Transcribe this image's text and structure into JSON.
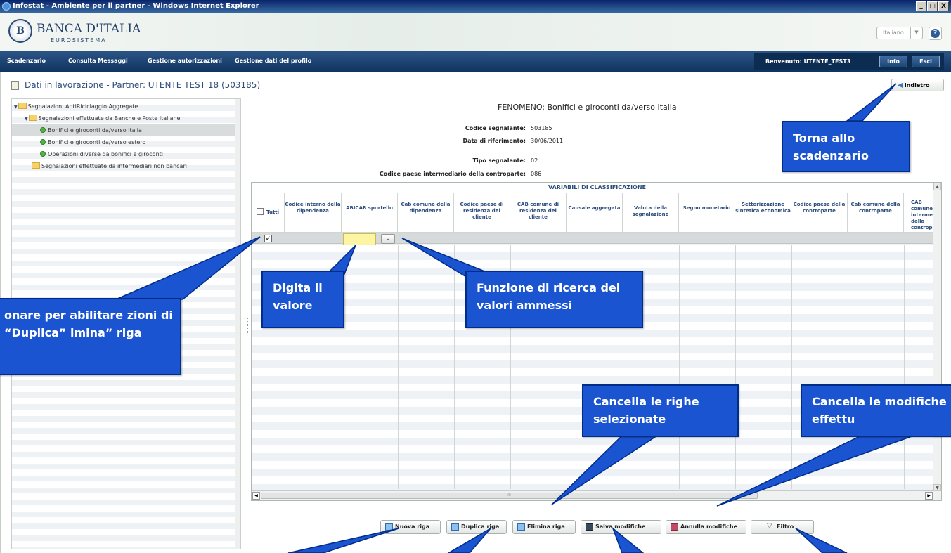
{
  "window": {
    "title": "Infostat - Ambiente per il partner - Windows Internet Explorer",
    "controls": [
      "_",
      "□",
      "X"
    ]
  },
  "header": {
    "logo_name": "BANCA D'ITALIA",
    "logo_sub": "EUROSISTEMA",
    "language": "Italiano",
    "help_icon": "question-icon"
  },
  "nav": {
    "items": [
      "Scadenzario",
      "Consulta Messaggi",
      "Gestione autorizzazioni",
      "Gestione dati del profilo"
    ],
    "welcome": "Benvenuto:  UTENTE_TEST3",
    "info": "Info",
    "exit": "Esci"
  },
  "page": {
    "title": "Dati in lavorazione - Partner: UTENTE TEST 18 (503185)",
    "back": "Indietro"
  },
  "tree": {
    "items": [
      "Segnalazioni AntiRiciclaggio Aggregate",
      "Segnalazioni effettuate da  Banche e Poste Italiane",
      "Bonifici e giroconti da/verso Italia",
      "Bonifici e giroconti da/verso estero",
      "Operazioni diverse da bonifici e giroconti",
      "Segnalazioni effettuate da intermediari non bancari"
    ]
  },
  "info": {
    "fenomeno": "FENOMENO: Bonifici e giroconti da/verso Italia",
    "rows": [
      {
        "label": "Codice segnalante:",
        "value": "503185"
      },
      {
        "label": "Data di riferimento:",
        "value": "30/06/2011"
      },
      {
        "label": "Tipo segnalante:",
        "value": "02"
      },
      {
        "label": "Codice paese intermediario della controparte:",
        "value": "086"
      }
    ]
  },
  "grid": {
    "group_header": "VARIABILI DI CLASSIFICAZIONE",
    "select_all": "Tutti",
    "columns": [
      "Codice interno della dipendenza",
      "ABICAB sportello",
      "Cab comune della dipendenza",
      "Codice paese di residenza del cliente",
      "CAB comune di residenza del cliente",
      "Causale aggregata",
      "Valuta della segnalazione",
      "Segno monetario",
      "Settorizzazione sintetica economica",
      "Codice paese della controparte",
      "Cab comune della controparte",
      "CAB comune intermediario della controparte"
    ],
    "row_checked": "✓",
    "abicab_value": "",
    "lookup_icon": "search-icon",
    "scroll_thumb": "III"
  },
  "toolbar": {
    "nuova": "Nuova riga",
    "duplica": "Duplica riga",
    "elimina": "Elimina riga",
    "salva": "Salva modifiche",
    "annulla": "Annulla modifiche",
    "filtro": "Filtro"
  },
  "callouts": {
    "torna": "Torna allo scadenzario",
    "digita": "Digita il valore",
    "funzione": "Funzione di ricerca dei valori ammessi",
    "seleziona": "onare per abilitare zioni di “Duplica” imina” riga",
    "cancella_righe": "Cancella le righe selezionate",
    "cancella_modifiche": "Cancella le modifiche effettu"
  },
  "colors": {
    "callout": "#1a54d1",
    "nav": "#1c4676",
    "title_text": "#2d4e7d"
  }
}
